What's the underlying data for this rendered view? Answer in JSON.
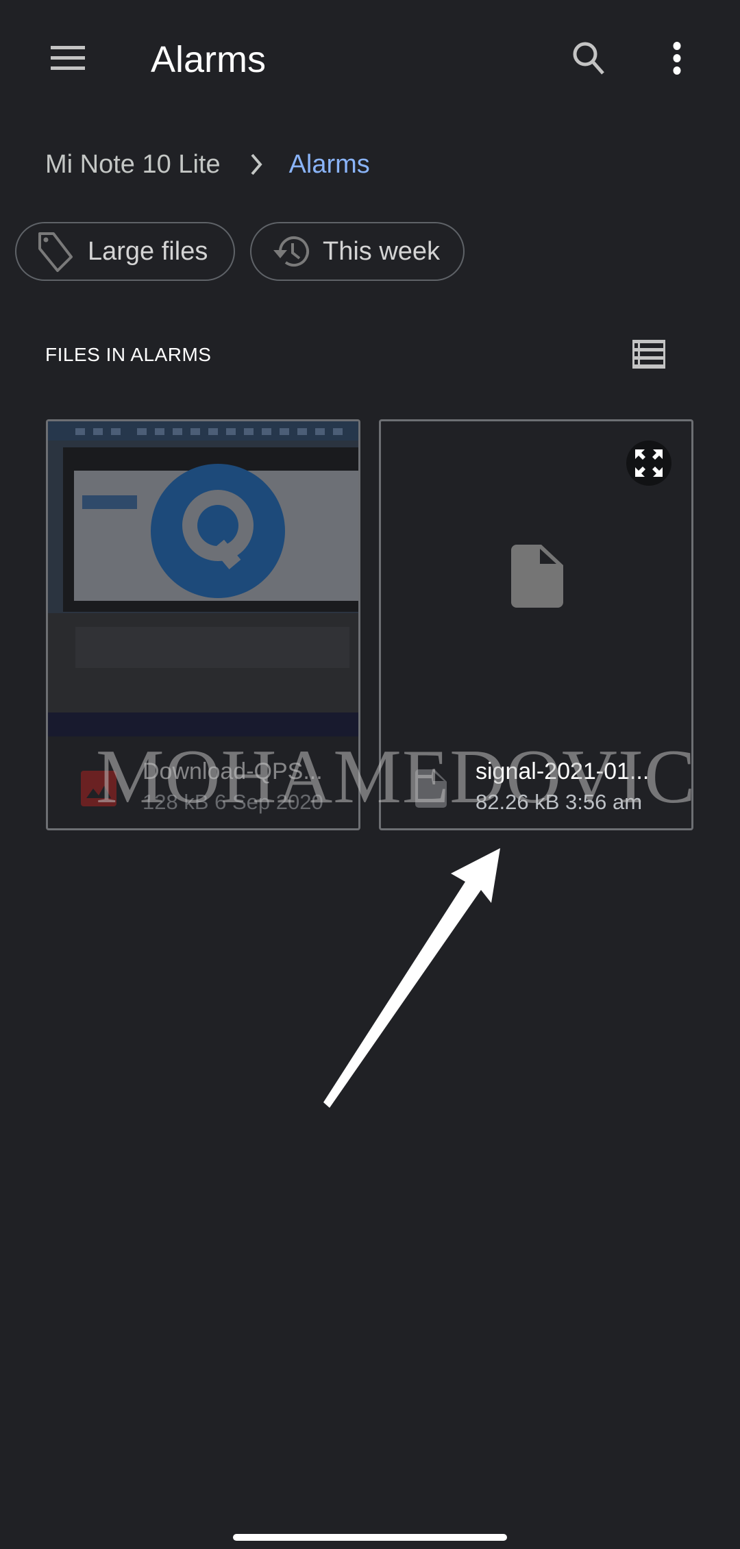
{
  "app_bar": {
    "title": "Alarms",
    "menu_icon": "hamburger-menu-icon",
    "search_icon": "search-icon",
    "more_icon": "more-vert-icon"
  },
  "breadcrumb": {
    "root": "Mi Note 10 Lite",
    "separator_icon": "chevron-right-icon",
    "current": "Alarms",
    "current_color": "#8ab4f8"
  },
  "chips": [
    {
      "label": "Large files",
      "icon": "tag-icon"
    },
    {
      "label": "This week",
      "icon": "history-icon"
    }
  ],
  "section": {
    "title": "FILES IN ALARMS",
    "view_toggle_icon": "list-view-icon"
  },
  "files": [
    {
      "name": "Download-QPS...",
      "size": "128 kB",
      "date": "6 Sep 2020",
      "type_icon": "image-icon",
      "type_color": "#c5221f",
      "thumbnail": "laptop-qpst-screenshot"
    },
    {
      "name": "signal-2021-01...",
      "size": "82.26 kB",
      "date": "3:56 am",
      "type_icon": "file-icon",
      "expand_icon": "fullscreen-icon"
    }
  ],
  "overlay": {
    "watermark": "MOHAMEDOVIC",
    "annotation": "white-arrow-pointing-to-signal-file"
  }
}
